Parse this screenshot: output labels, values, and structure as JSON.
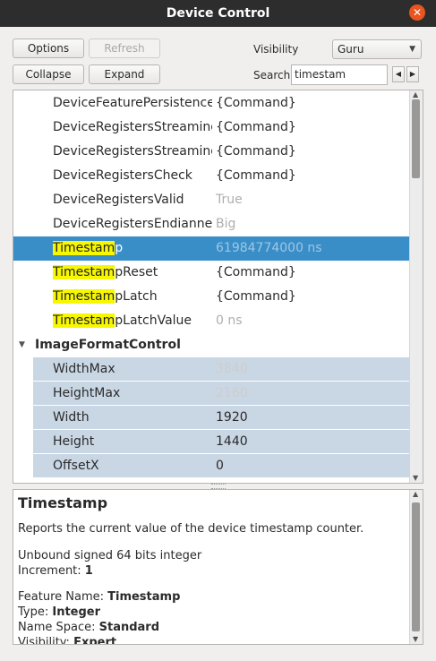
{
  "window": {
    "title": "Device Control",
    "close_glyph": "✕"
  },
  "toolbar": {
    "options_label": "Options",
    "refresh_label": "Refresh",
    "collapse_label": "Collapse",
    "expand_label": "Expand",
    "visibility_label": "Visibility",
    "visibility_value": "Guru",
    "search_label": "Search",
    "search_value": "timestam",
    "search_prev": "◀",
    "search_next": "▶"
  },
  "tree": {
    "rows": [
      {
        "name": "DeviceFeaturePersistence",
        "value": "{Command}"
      },
      {
        "name": "DeviceRegistersStreamingStart",
        "value": "{Command}"
      },
      {
        "name": "DeviceRegistersStreamingEnd",
        "value": "{Command}"
      },
      {
        "name": "DeviceRegistersCheck",
        "value": "{Command}"
      },
      {
        "name": "DeviceRegistersValid",
        "value": "True"
      },
      {
        "name": "DeviceRegistersEndianness",
        "value": "Big"
      },
      {
        "match": "Timestam",
        "rest": "p",
        "value": "61984774000 ns"
      },
      {
        "match": "Timestam",
        "rest": "pReset",
        "value": "{Command}"
      },
      {
        "match": "Timestam",
        "rest": "pLatch",
        "value": "{Command}"
      },
      {
        "match": "Timestam",
        "rest": "pLatchValue",
        "value": "0 ns"
      }
    ],
    "category": {
      "name": "ImageFormatControl",
      "expander": "▼"
    },
    "children": [
      {
        "name": "WidthMax",
        "value": "3840"
      },
      {
        "name": "HeightMax",
        "value": "2160"
      },
      {
        "name": "Width",
        "value": "1920"
      },
      {
        "name": "Height",
        "value": "1440"
      },
      {
        "name": "OffsetX",
        "value": "0"
      }
    ],
    "scroll_up": "▲",
    "scroll_down": "▼"
  },
  "description": {
    "title": "Timestamp",
    "text": "Reports the current value of the device timestamp counter.",
    "type_line": "Unbound signed 64 bits integer",
    "increment_label": "Increment: ",
    "increment_value": "1",
    "feature_name_label": "Feature Name: ",
    "feature_name_value": "Timestamp",
    "type_label": "Type: ",
    "type_value": "Integer",
    "namespace_label": "Name Space: ",
    "namespace_value": "Standard",
    "visibility_label": "Visibility: ",
    "visibility_value": "Expert"
  },
  "colors": {
    "selection": "#3a8ec8",
    "highlight": "#f7f700",
    "category_band": "#c9d6e4",
    "titlebar": "#2d2d2d",
    "close": "#e95420"
  }
}
